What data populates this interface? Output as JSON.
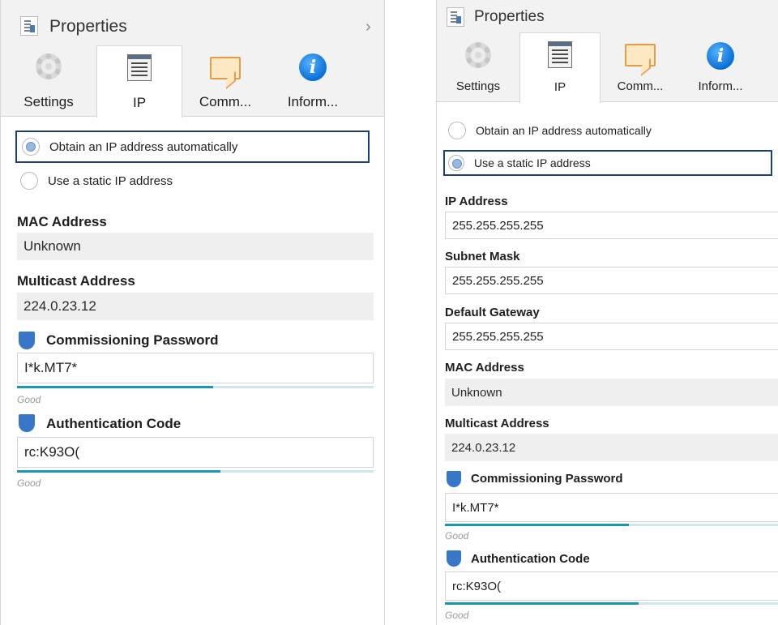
{
  "panel_left": {
    "title": "Properties",
    "collapse_glyph": "›",
    "tabs": [
      {
        "label": "Settings",
        "icon": "gear-icon"
      },
      {
        "label": "IP",
        "icon": "list-icon"
      },
      {
        "label": "Comm...",
        "icon": "comment-icon"
      },
      {
        "label": "Inform...",
        "icon": "info-icon"
      }
    ],
    "active_tab": "IP",
    "radio_auto": "Obtain an IP address automatically",
    "radio_static": "Use a static IP address",
    "selected_option": "auto",
    "mac_label": "MAC Address",
    "mac_value": "Unknown",
    "multicast_label": "Multicast Address",
    "multicast_value": "224.0.23.12",
    "commissioning_label": "Commissioning Password",
    "commissioning_value": "I*k.MT7*",
    "commissioning_strength_text": "Good",
    "commissioning_strength": 0.55,
    "auth_label": "Authentication Code",
    "auth_value": "rc:K93O(",
    "auth_strength_text": "Good",
    "auth_strength": 0.57
  },
  "panel_right": {
    "title": "Properties",
    "tabs": [
      {
        "label": "Settings",
        "icon": "gear-icon"
      },
      {
        "label": "IP",
        "icon": "list-icon"
      },
      {
        "label": "Comm...",
        "icon": "comment-icon"
      },
      {
        "label": "Inform...",
        "icon": "info-icon"
      }
    ],
    "active_tab": "IP",
    "radio_auto": "Obtain an IP address automatically",
    "radio_static": "Use a static IP address",
    "selected_option": "static",
    "ip_label": "IP Address",
    "ip_value": "255.255.255.255",
    "subnet_label": "Subnet Mask",
    "subnet_value": "255.255.255.255",
    "gateway_label": "Default Gateway",
    "gateway_value": "255.255.255.255",
    "mac_label": "MAC Address",
    "mac_value": "Unknown",
    "multicast_label": "Multicast Address",
    "multicast_value": "224.0.23.12",
    "commissioning_label": "Commissioning Password",
    "commissioning_value": "I*k.MT7*",
    "commissioning_strength_text": "Good",
    "commissioning_strength": 0.55,
    "auth_label": "Authentication Code",
    "auth_value": "rc:K93O(",
    "auth_strength_text": "Good",
    "auth_strength": 0.58
  },
  "colors": {
    "focus_border": "#1d3f73",
    "strength_fill": "#1a97b0",
    "shield": "#3877c7",
    "panel_header": "#f2f2f2"
  }
}
